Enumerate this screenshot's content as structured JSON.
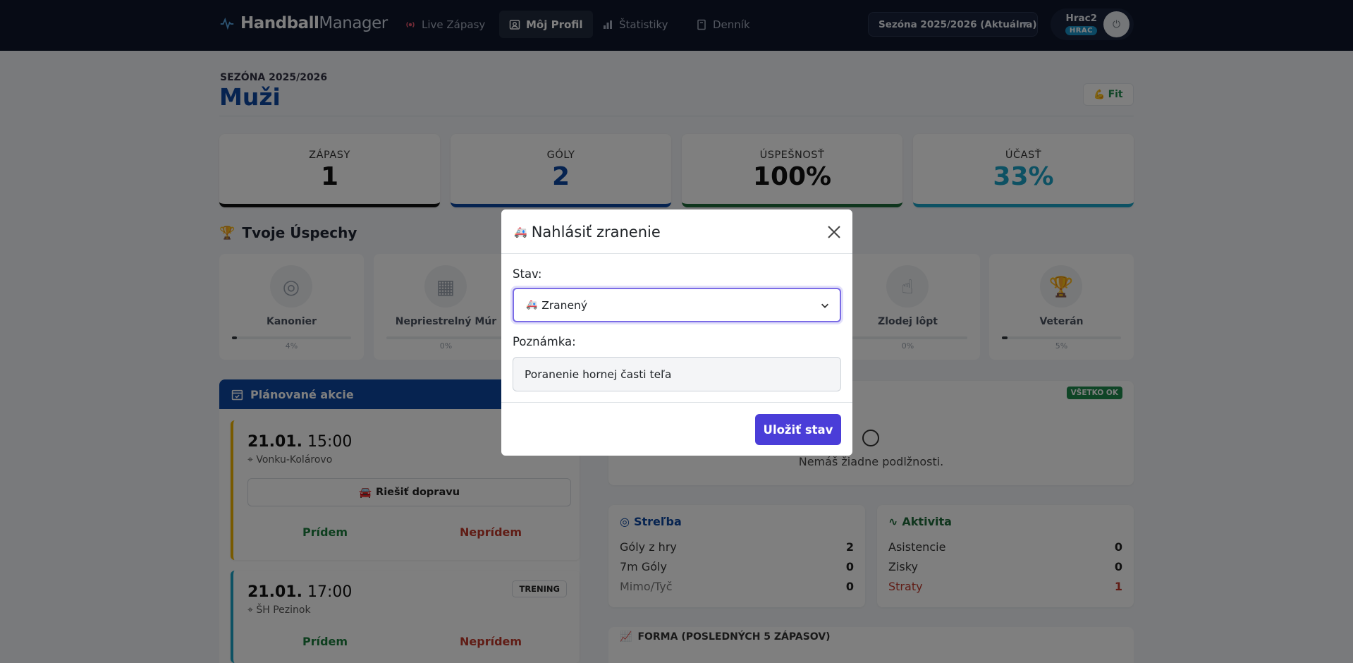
{
  "navbar": {
    "brand_bold": "Handball",
    "brand_light": "Manager",
    "items": [
      {
        "label": "Live Zápasy",
        "icon": "broadcast-icon"
      },
      {
        "label": "Môj Profil",
        "icon": "user-icon",
        "active": true
      },
      {
        "label": "Štatistiky",
        "icon": "bar-chart-icon"
      },
      {
        "label": "Denník",
        "icon": "journal-icon"
      }
    ],
    "season_select": "Sezóna 2025/2026 (Aktuálna)",
    "user_name": "Hrac2",
    "user_role": "HRAC"
  },
  "header": {
    "season": "SEZÓNA 2025/2026",
    "team": "Muži",
    "fit_label": "Fit"
  },
  "stats": [
    {
      "label": "ZÁPASY",
      "value": "1",
      "color": "#111111"
    },
    {
      "label": "GÓLY",
      "value": "2",
      "color": "#0d47a1"
    },
    {
      "label": "ÚSPEŠNOSŤ",
      "value": "100%",
      "color": "#111111"
    },
    {
      "label": "ÚČASŤ",
      "value": "33%",
      "color": "#1aa3c7"
    }
  ],
  "achievements": {
    "title": "Tvoje Úspechy",
    "items": [
      {
        "name": "Kanonier",
        "pct": "4%",
        "progress": 0.04
      },
      {
        "name": "Nepriestrelný Múr",
        "pct": "0%",
        "progress": 0
      },
      {
        "name": "Zlodej lôpt",
        "pct": "0%",
        "progress": 0
      },
      {
        "name": "Veterán",
        "pct": "5%",
        "progress": 0.05
      }
    ]
  },
  "planned": {
    "title": "Plánované akcie",
    "events": [
      {
        "date": "21.01.",
        "time": "15:00",
        "location": "Vonku-Kolárovo",
        "transport": "Riešiť dopravu",
        "yes": "Prídem",
        "no": "Neprídem",
        "accent": "#f0b400"
      },
      {
        "date": "21.01.",
        "time": "17:00",
        "location": "ŠH Pezinok",
        "tag": "TRENING",
        "yes": "Prídem",
        "no": "Neprídem",
        "accent": "#1aa3c7"
      }
    ]
  },
  "debts": {
    "badge": "VŠETKO OK",
    "message": "Nemáš žiadne podlžnosti."
  },
  "shooting": {
    "title": "Streľba",
    "rows": [
      {
        "label": "Góly z hry",
        "value": "2"
      },
      {
        "label": "7m Góly",
        "value": "0"
      },
      {
        "label": "Mimo/Tyč",
        "value": "0"
      }
    ]
  },
  "activity": {
    "title": "Aktivita",
    "rows": [
      {
        "label": "Asistencie",
        "value": "0"
      },
      {
        "label": "Zisky",
        "value": "0"
      },
      {
        "label": "Straty",
        "value": "1"
      }
    ]
  },
  "forma": {
    "title": "FORMA (POSLEDNÝCH 5 ZÁPASOV)"
  },
  "modal": {
    "title": "Nahlásiť zranenie",
    "status_label": "Stav:",
    "status_value": "Zranený",
    "note_label": "Poznámka:",
    "note_value": "Poranenie hornej časti teľa",
    "save_label": "Uložiť stav"
  }
}
